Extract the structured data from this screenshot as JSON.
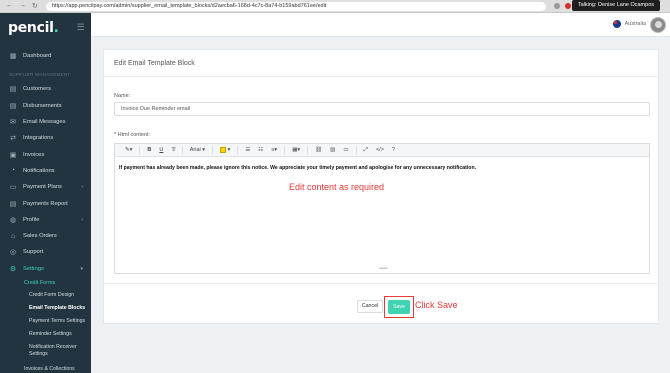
{
  "browser": {
    "url": "https://app.pencilpay.com/admin/supplier_email_template_blocks/d2aecba6-168d-4c7c-8a74-b159abd761ee/edit",
    "nav_back": "←",
    "nav_forward": "→",
    "nav_reload": "↻",
    "call_banner": "Talking: Denise Lane Ocampos"
  },
  "sidebar": {
    "logo_text": "pencil",
    "logo_dot": ".",
    "dashboard": "Dashboard",
    "section_label": "SUPPLIER MANAGEMENT",
    "items": [
      {
        "label": "Customers",
        "icon": "users-icon",
        "glyph": "▤"
      },
      {
        "label": "Disbursements",
        "icon": "disbursements-icon",
        "glyph": "▤"
      },
      {
        "label": "Email Messages",
        "icon": "email-icon",
        "glyph": "✉"
      },
      {
        "label": "Integrations",
        "icon": "integrations-icon",
        "glyph": "⇄"
      },
      {
        "label": "Invoices",
        "icon": "invoices-icon",
        "glyph": "▣"
      },
      {
        "label": "Notifications",
        "icon": "bell-icon",
        "glyph": "◔"
      },
      {
        "label": "Payment Plans",
        "icon": "payment-plans-icon",
        "glyph": "▭"
      },
      {
        "label": "Payments Report",
        "icon": "report-icon",
        "glyph": "▤"
      },
      {
        "label": "Profile",
        "icon": "profile-icon",
        "glyph": "◍"
      },
      {
        "label": "Sales Orders",
        "icon": "sales-orders-icon",
        "glyph": "⌂"
      },
      {
        "label": "Support",
        "icon": "support-icon",
        "glyph": "◎"
      },
      {
        "label": "Settings",
        "icon": "settings-icon",
        "glyph": "⚙"
      }
    ],
    "credit_forms": "Credit Forms",
    "sub_items": [
      "Credit Form Design",
      "Email Template Blocks",
      "Payment Terms Settings",
      "Reminder Settings",
      "Notification Receiver Settings",
      "Invoices & Collections"
    ]
  },
  "topbar": {
    "region": "Australia"
  },
  "card": {
    "title": "Edit Email Template Block",
    "name_label": "Name:",
    "name_value": "Invoice Due Reminder email",
    "content_label": "* Html content:",
    "font_family": "Arial",
    "notice_text": "If payment has already been made, please ignore this notice. We appreciate your timely payment and apologise for any unnecessary notification.",
    "cancel_label": "Cancel",
    "save_label": "Save"
  },
  "annotations": {
    "edit_note": "Edit content as required",
    "save_note": "Click Save"
  },
  "colors": {
    "sidebar_bg": "#22343f",
    "accent": "#3fd3b1",
    "annotation": "#e53935"
  }
}
